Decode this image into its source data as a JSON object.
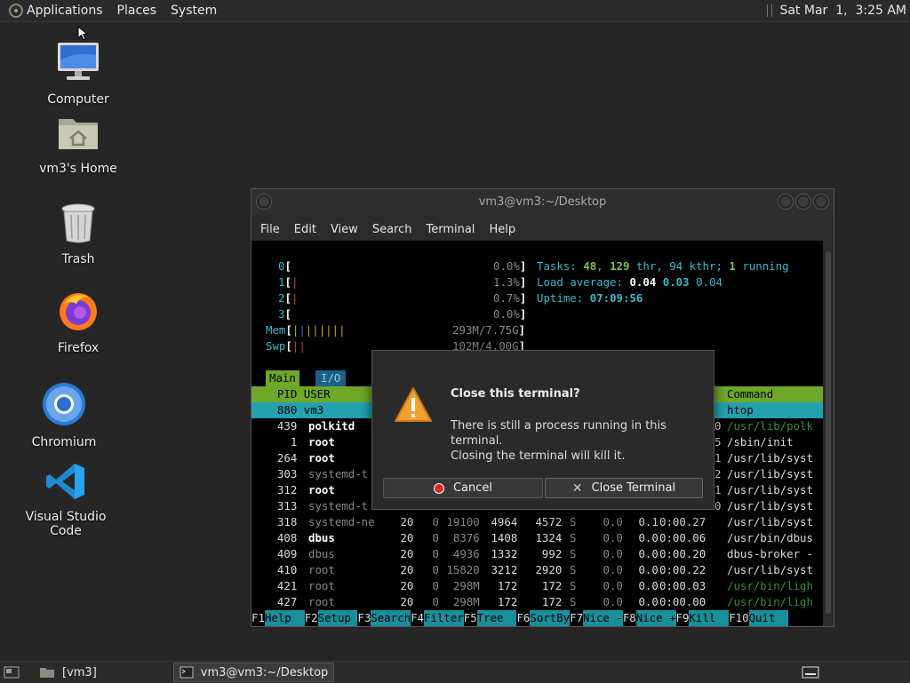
{
  "top_panel": {
    "menus": [
      "Applications",
      "Places",
      "System"
    ],
    "clock": "Sat Mar  1,  3:25 AM"
  },
  "desktop_icons": [
    {
      "label": "Computer",
      "icon": "computer-icon"
    },
    {
      "label": "vm3's Home",
      "icon": "home-folder-icon"
    },
    {
      "label": "Trash",
      "icon": "trash-icon"
    },
    {
      "label": "Firefox",
      "icon": "firefox-icon"
    },
    {
      "label": "Chromium",
      "icon": "chromium-icon"
    },
    {
      "label": "Visual Studio Code",
      "icon": "vscode-icon"
    }
  ],
  "terminal": {
    "title": "vm3@vm3:~/Desktop",
    "menus": [
      "File",
      "Edit",
      "View",
      "Search",
      "Terminal",
      "Help"
    ],
    "cpus": [
      {
        "id": "0",
        "pct": "0.0%"
      },
      {
        "id": "1",
        "pct": "1.3%"
      },
      {
        "id": "2",
        "pct": "0.7%"
      },
      {
        "id": "3",
        "pct": "0.0%"
      }
    ],
    "mem": "293M/7.75G",
    "swp": "102M/4.00G",
    "tasks": {
      "label": "Tasks:",
      "count": "48",
      "thr": "129",
      "thr_label": "thr,",
      "kthr": "94 kthr;",
      "running": "1",
      "running_label": "running"
    },
    "load": {
      "label": "Load average:",
      "v1": "0.04",
      "v2": "0.03",
      "v3": "0.04"
    },
    "uptime": {
      "label": "Uptime:",
      "value": "07:09:56"
    },
    "tabs": [
      "Main",
      "I/O"
    ],
    "header": {
      "left": "  PID USER",
      "right": "Command"
    },
    "selected": {
      "left": "  880 vm3",
      "right": "htop"
    },
    "processes": [
      {
        "pid": "439",
        "user": "polkitd",
        "tail": "0 /usr/lib/polk"
      },
      {
        "pid": "1",
        "user": "root",
        "tail": "5 /sbin/init"
      },
      {
        "pid": "264",
        "user": "root",
        "tail": "1 /usr/lib/syst"
      },
      {
        "pid": "303",
        "user": "systemd-t",
        "tail": "2 /usr/lib/syst"
      },
      {
        "pid": "312",
        "user": "root",
        "tail": "1 /usr/lib/syst"
      },
      {
        "pid": "313",
        "user": "systemd-t",
        "tail": "0 /usr/lib/syst"
      },
      {
        "pid": "318",
        "user": "systemd-ne",
        "pri": "20",
        "ni": "0",
        "virt": "19100",
        "res": "4964",
        "shr": "4572",
        "s": "S",
        "cpu": "0.0",
        "mem": "0.1",
        "time": "0:00.27",
        "cmd": "/usr/lib/syst"
      },
      {
        "pid": "408",
        "user": "dbus",
        "pri": "20",
        "ni": "0",
        "virt": "8376",
        "res": "1408",
        "shr": "1324",
        "s": "S",
        "cpu": "0.0",
        "mem": "0.0",
        "time": "0:00.06",
        "cmd": "/usr/bin/dbus"
      },
      {
        "pid": "409",
        "user": "dbus",
        "pri": "20",
        "ni": "0",
        "virt": "4936",
        "res": "1332",
        "shr": "992",
        "s": "S",
        "cpu": "0.0",
        "mem": "0.0",
        "time": "0:00.20",
        "cmd": "dbus-broker -"
      },
      {
        "pid": "410",
        "user": "root",
        "pri": "20",
        "ni": "0",
        "virt": "15820",
        "res": "3212",
        "shr": "2920",
        "s": "S",
        "cpu": "0.0",
        "mem": "0.0",
        "time": "0:00.22",
        "cmd": "/usr/lib/syst"
      },
      {
        "pid": "421",
        "user": "root",
        "pri": "20",
        "ni": "0",
        "virt": "298M",
        "res": "172",
        "shr": "172",
        "s": "S",
        "cpu": "0.0",
        "mem": "0.0",
        "time": "0:00.03",
        "cmd": "/usr/bin/ligh"
      },
      {
        "pid": "427",
        "user": "root",
        "pri": "20",
        "ni": "0",
        "virt": "298M",
        "res": "172",
        "shr": "172",
        "s": "S",
        "cpu": "0.0",
        "mem": "0.0",
        "time": "0:00.00",
        "cmd": "/usr/bin/ligh"
      }
    ],
    "fkeys": [
      {
        "key": "F1",
        "label": "Help  "
      },
      {
        "key": "F2",
        "label": "Setup "
      },
      {
        "key": "F3",
        "label": "Search"
      },
      {
        "key": "F4",
        "label": "Filter"
      },
      {
        "key": "F5",
        "label": "Tree  "
      },
      {
        "key": "F6",
        "label": "SortBy"
      },
      {
        "key": "F7",
        "label": "Nice -"
      },
      {
        "key": "F8",
        "label": "Nice +"
      },
      {
        "key": "F9",
        "label": "Kill  "
      },
      {
        "key": "F10",
        "label": "Quit  "
      }
    ]
  },
  "dialog": {
    "title": "Close this terminal?",
    "message_line1": "There is still a process running in this terminal.",
    "message_line2": "Closing the terminal will kill it.",
    "cancel_label": "Cancel",
    "close_label": "Close Terminal"
  },
  "bottom_panel": {
    "tasks": [
      "[vm3]",
      "vm3@vm3:~/Desktop"
    ]
  }
}
